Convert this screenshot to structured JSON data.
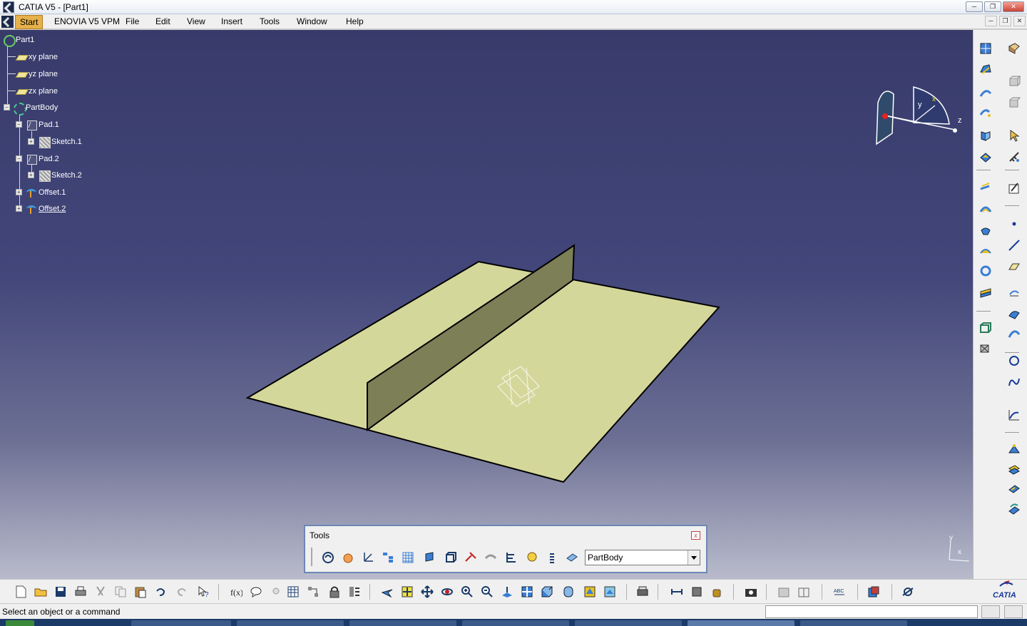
{
  "window": {
    "title": "CATIA V5 - [Part1]"
  },
  "menubar": {
    "items": [
      "Start",
      "ENOVIA V5 VPM",
      "File",
      "Edit",
      "View",
      "Insert",
      "Tools",
      "Window",
      "Help"
    ]
  },
  "tree": {
    "root": "Part1",
    "planes": [
      "xy plane",
      "yz plane",
      "zx plane"
    ],
    "body": "PartBody",
    "features": [
      {
        "label": "Pad.1",
        "child": "Sketch.1"
      },
      {
        "label": "Pad.2",
        "child": "Sketch.2"
      }
    ],
    "offsets": [
      "Offset.1",
      "Offset.2"
    ]
  },
  "compass": {
    "x": "x",
    "y": "y",
    "z": "z"
  },
  "triad": {
    "x": "x",
    "y": "y"
  },
  "tools_toolbar": {
    "title": "Tools",
    "close": "x",
    "current_body": "PartBody"
  },
  "status": {
    "message": "Select an object or a command"
  },
  "logo": {
    "text": "CATIA"
  },
  "colors": {
    "surface": "#d4d79a",
    "wall": "#7d7f56",
    "viewport_top": "#383b6a",
    "viewport_bottom": "#b9bbcc"
  }
}
